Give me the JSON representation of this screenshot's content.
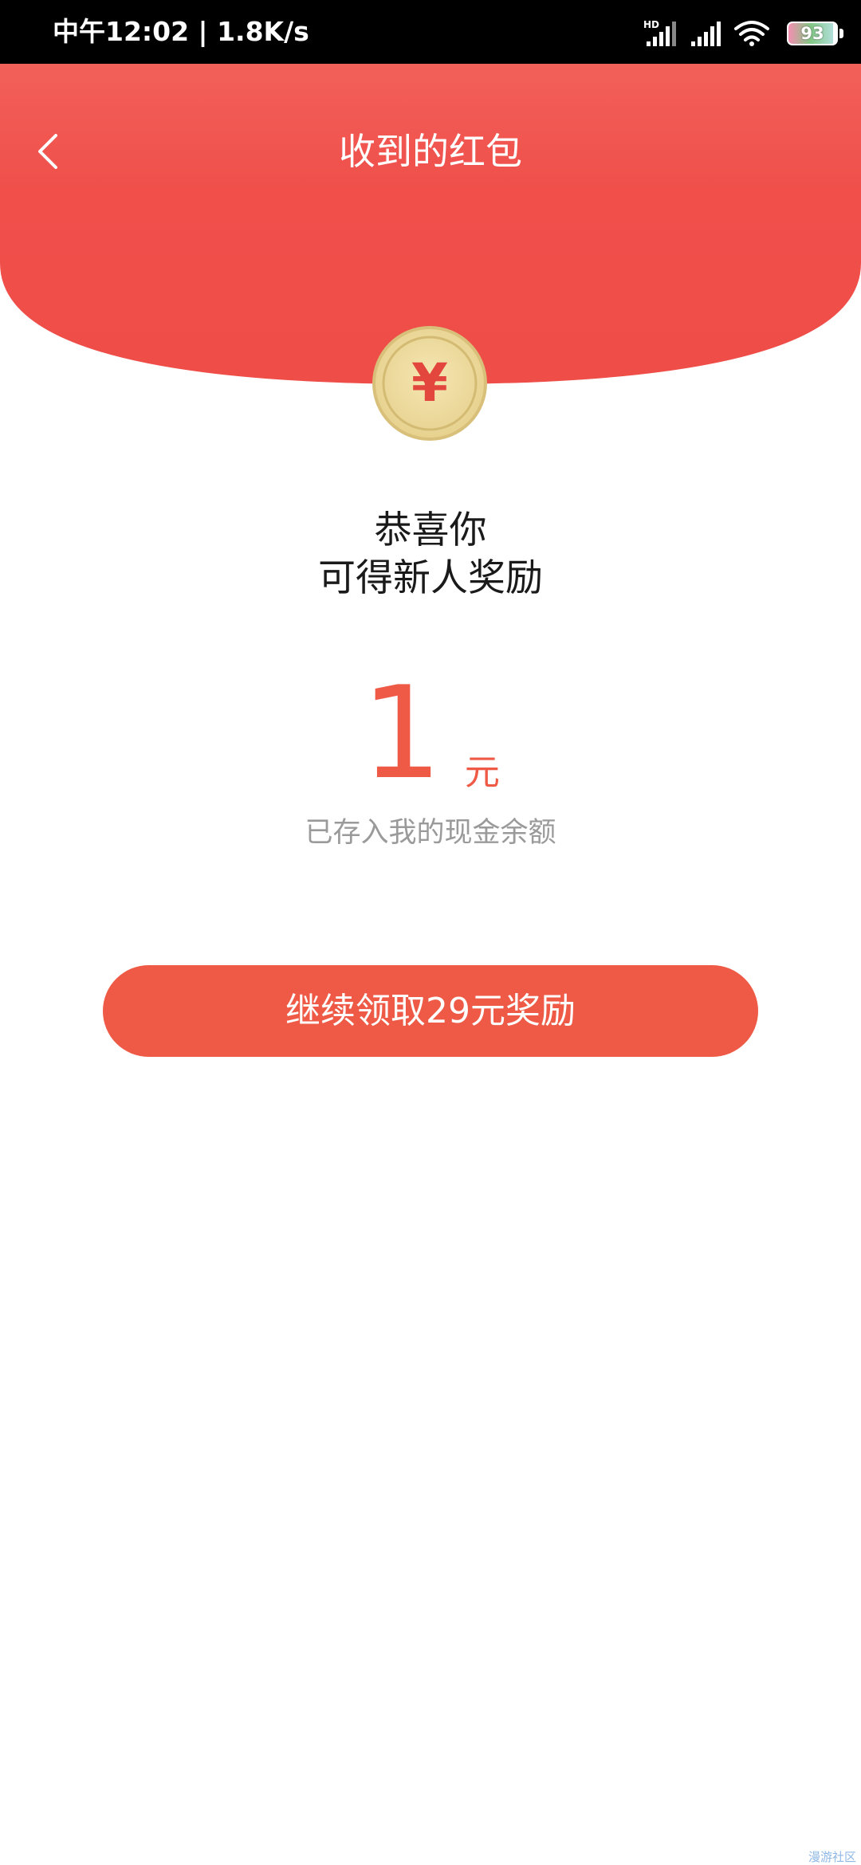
{
  "status_bar": {
    "time_speed": "中午12:02 | 1.8K/s",
    "battery_level": "93",
    "battery_fraction": 0.93,
    "icons": [
      "hd-signal-icon",
      "signal-icon",
      "wifi-icon",
      "battery-icon"
    ]
  },
  "header": {
    "title": "收到的红包",
    "back_icon": "chevron-left-icon",
    "color": "#f04f4a"
  },
  "coin": {
    "symbol": "¥",
    "icon": "yuan-coin-icon"
  },
  "message": {
    "line1": "恭喜你",
    "line2": "可得新人奖励"
  },
  "reward": {
    "amount": "1",
    "unit": "元",
    "note": "已存入我的现金余额",
    "accent_color": "#ee5a46"
  },
  "actions": {
    "continue_label": "继续领取29元奖励"
  },
  "watermark": "漫游社区"
}
